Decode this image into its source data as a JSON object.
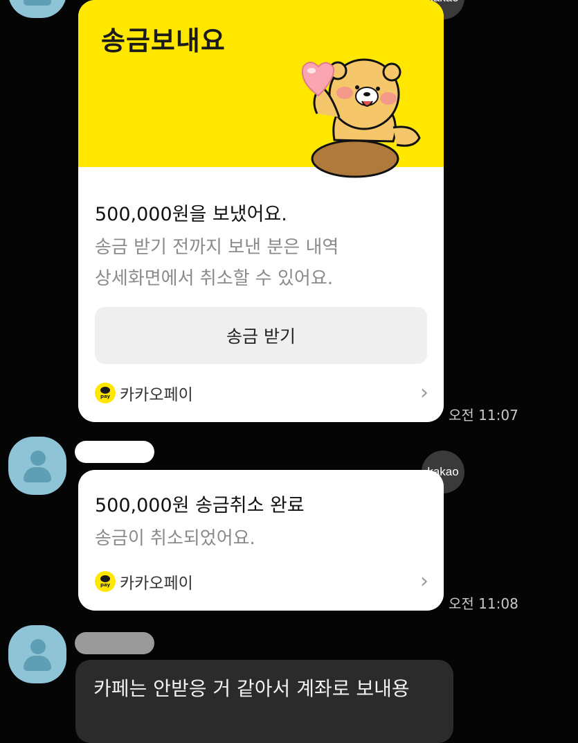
{
  "card1": {
    "title": "송금보내요",
    "amount_text": "500,000원을 보냈어요.",
    "desc_line1": "송금 받기 전까지 보낸 분은 내역",
    "desc_line2": "상세화면에서 취소할 수 있어요.",
    "button_label": "송금 받기",
    "pay_label": "카카오페이",
    "pay_logo_text": "pay",
    "time": "오전 11:07",
    "badge": "kakao"
  },
  "card2": {
    "amount_text": "500,000원 송금취소 완료",
    "desc": "송금이 취소되었어요.",
    "pay_label": "카카오페이",
    "pay_logo_text": "pay",
    "time": "오전 11:08",
    "badge": "kakao"
  },
  "message": {
    "text": "카페는 안받응 거 같아서 계좌로 보내용"
  },
  "colors": {
    "background": "#050505",
    "kakao_yellow": "#ffe700",
    "avatar": "#8fc3d6"
  },
  "icons": {
    "chevron": "chevron-right-icon",
    "avatar": "user-avatar-icon"
  }
}
